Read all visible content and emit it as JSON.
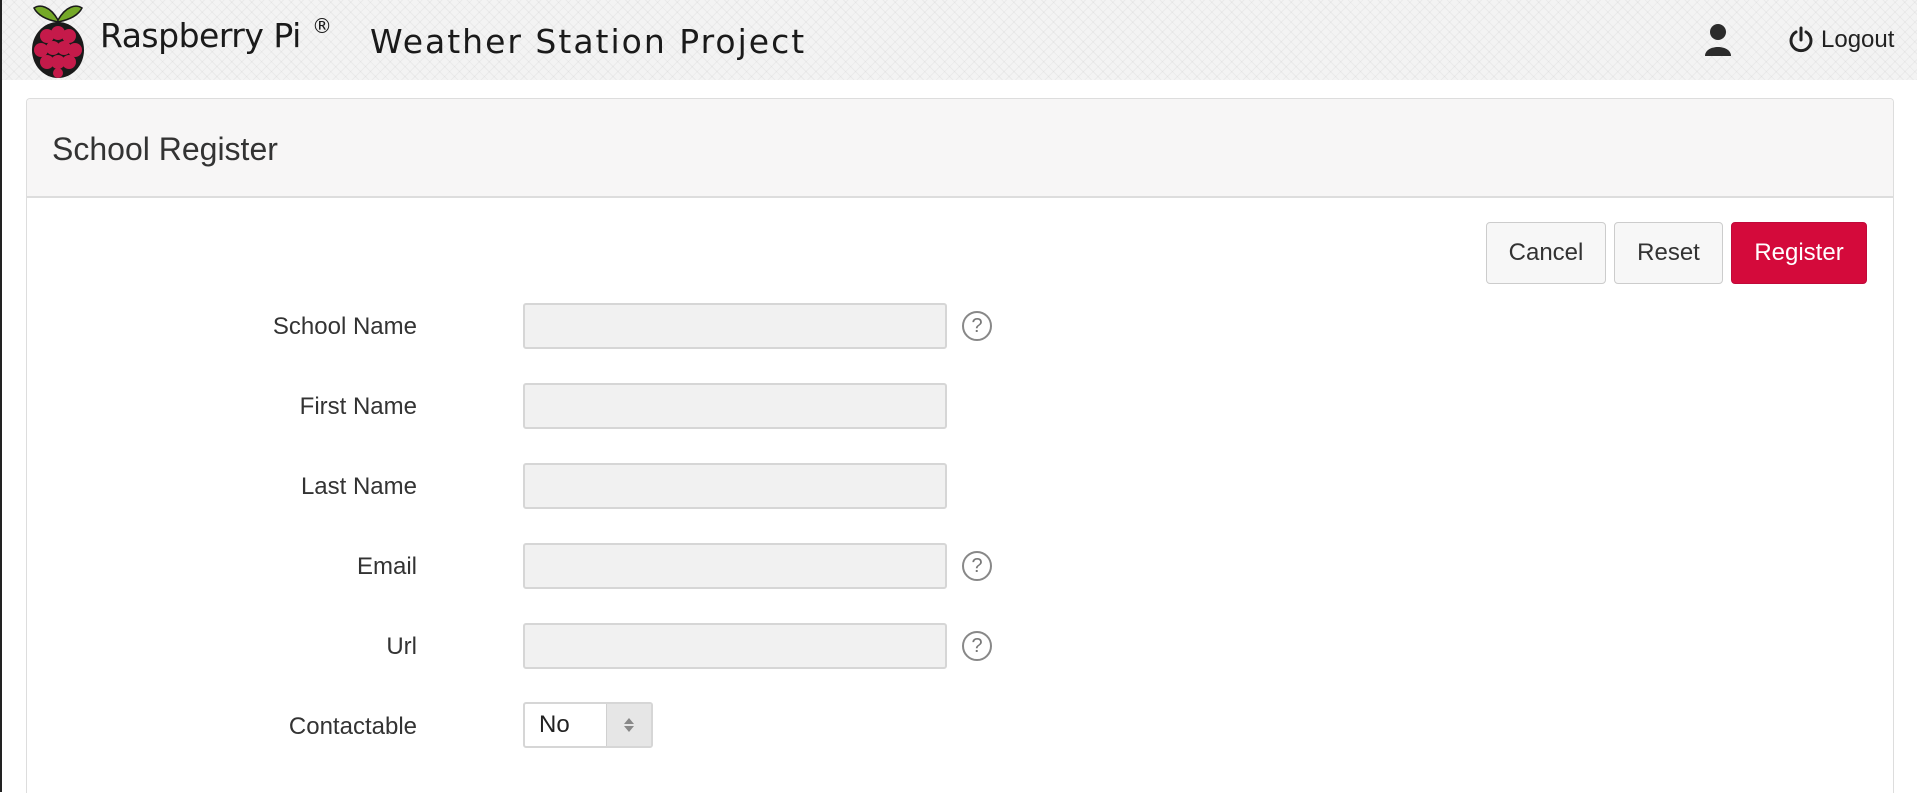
{
  "header": {
    "brand": "Raspberry Pi",
    "brand_mark": "®",
    "title": "Weather Station Project",
    "logo_icon": "raspberry-pi-logo",
    "user_icon": "user-icon",
    "logout_icon": "power-icon",
    "logout_label": "Logout"
  },
  "panel": {
    "title": "School Register"
  },
  "buttons": {
    "cancel": "Cancel",
    "reset": "Reset",
    "register": "Register"
  },
  "form": {
    "school_name": {
      "label": "School Name",
      "value": "",
      "help_icon": "?"
    },
    "first_name": {
      "label": "First Name",
      "value": ""
    },
    "last_name": {
      "label": "Last Name",
      "value": ""
    },
    "email": {
      "label": "Email",
      "value": "",
      "help_icon": "?"
    },
    "url": {
      "label": "Url",
      "value": "",
      "help_icon": "?"
    },
    "contactable": {
      "label": "Contactable",
      "value": "No"
    }
  },
  "colors": {
    "accent": "#d40a3b",
    "raspberry_red": "#c51a4a",
    "leaf_green": "#75a928"
  }
}
